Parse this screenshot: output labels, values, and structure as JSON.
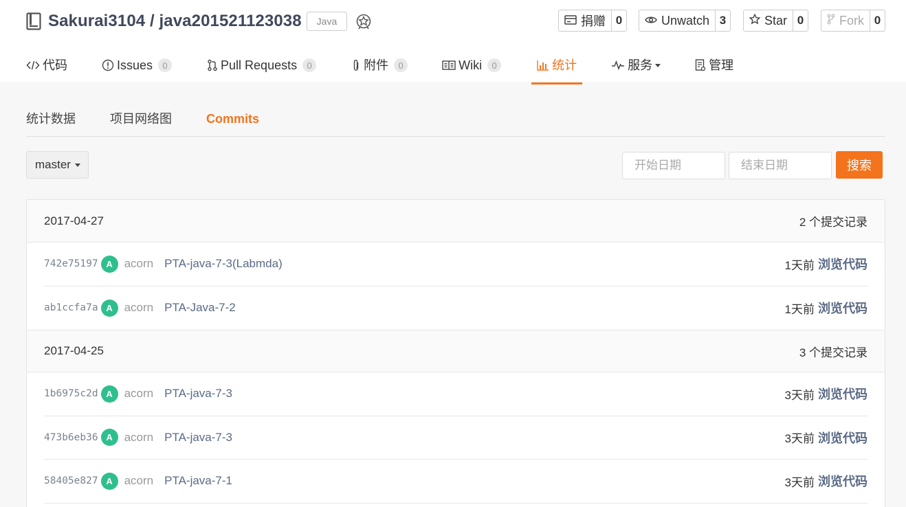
{
  "repo": {
    "title": "Sakurai3104 / java201521123038",
    "language": "Java"
  },
  "actions": {
    "donate": {
      "label": "捐赠",
      "count": "0"
    },
    "watch": {
      "label": "Unwatch",
      "count": "3"
    },
    "star": {
      "label": "Star",
      "count": "0"
    },
    "fork": {
      "label": "Fork",
      "count": "0"
    }
  },
  "nav": {
    "code": {
      "label": "代码"
    },
    "issues": {
      "label": "Issues",
      "count": "0"
    },
    "pulls": {
      "label": "Pull Requests",
      "count": "0"
    },
    "attachments": {
      "label": "附件",
      "count": "0"
    },
    "wiki": {
      "label": "Wiki",
      "count": "0"
    },
    "stats": {
      "label": "统计"
    },
    "services": {
      "label": "服务"
    },
    "manage": {
      "label": "管理"
    }
  },
  "subtabs": [
    "统计数据",
    "项目网络图",
    "Commits"
  ],
  "filters": {
    "branch": "master",
    "start_placeholder": "开始日期",
    "end_placeholder": "结束日期",
    "search_label": "搜索"
  },
  "groups": [
    {
      "date": "2017-04-27",
      "count_text": "2 个提交记录",
      "commits": [
        {
          "sha": "742e75197",
          "avatar": "A",
          "author": "acorn",
          "message": "PTA-java-7-3(Labmda)",
          "time": "1天前",
          "browse": "浏览代码"
        },
        {
          "sha": "ab1ccfa7a",
          "avatar": "A",
          "author": "acorn",
          "message": "PTA-Java-7-2",
          "time": "1天前",
          "browse": "浏览代码"
        }
      ]
    },
    {
      "date": "2017-04-25",
      "count_text": "3 个提交记录",
      "commits": [
        {
          "sha": "1b6975c2d",
          "avatar": "A",
          "author": "acorn",
          "message": "PTA-java-7-3",
          "time": "3天前",
          "browse": "浏览代码"
        },
        {
          "sha": "473b6eb36",
          "avatar": "A",
          "author": "acorn",
          "message": "PTA-java-7-3",
          "time": "3天前",
          "browse": "浏览代码"
        },
        {
          "sha": "58405e827",
          "avatar": "A",
          "author": "acorn",
          "message": "PTA-java-7-1",
          "time": "3天前",
          "browse": "浏览代码"
        }
      ]
    }
  ],
  "colors": {
    "accent": "#f4731d",
    "avatar": "#2fbf8f",
    "link": "#5a6a85"
  }
}
